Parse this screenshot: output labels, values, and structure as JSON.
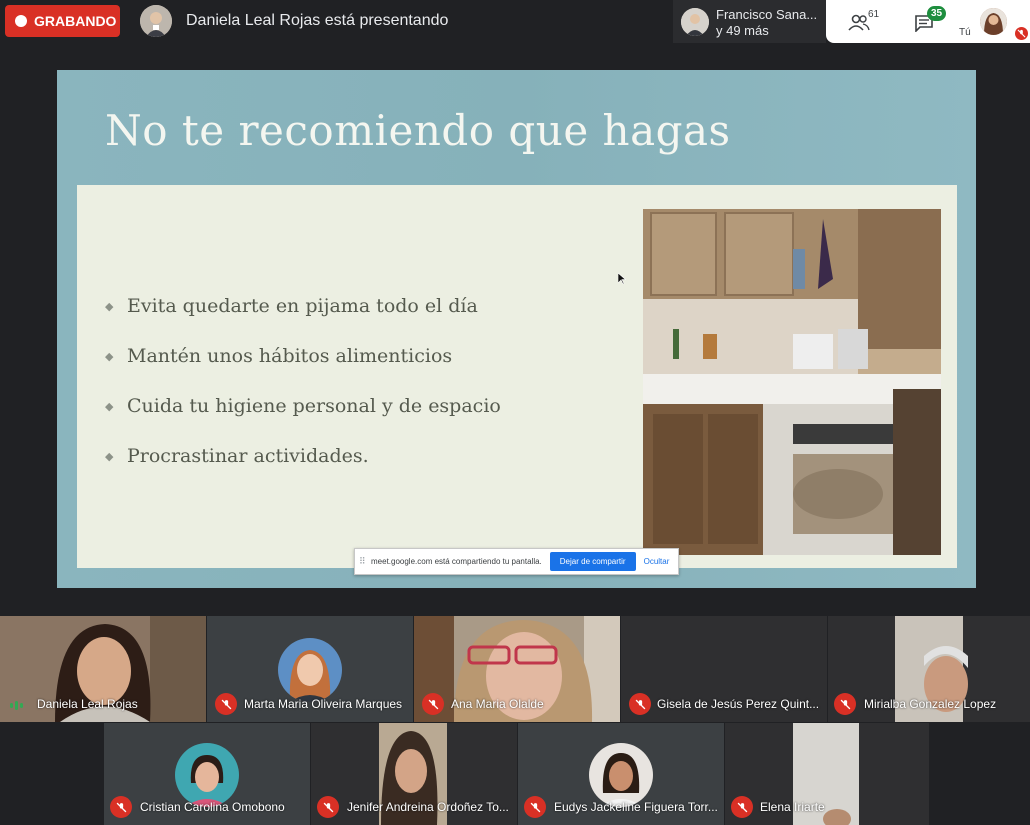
{
  "topbar": {
    "recording_label": "GRABANDO",
    "presenter_text": "Daniela Leal Rojas está presentando",
    "others_line1": "Francisco Sana...",
    "others_line2": "y 49 más",
    "people_count": "61",
    "chat_count": "35",
    "self_label": "Tú"
  },
  "slide": {
    "title": "No te recomiendo que hagas",
    "bullet_mark": "◆",
    "bullets": [
      "Evita quedarte en pijama todo el día",
      "Mantén unos hábitos alimenticios",
      "Cuida tu higiene personal y de espacio",
      "Procrastinar actividades."
    ]
  },
  "share_bar": {
    "handle": "⠿",
    "text": "meet.google.com está compartiendo tu pantalla.",
    "stop_label": "Dejar de compartir",
    "hide_label": "Ocultar"
  },
  "participants": [
    {
      "name": "Daniela Leal Rojas"
    },
    {
      "name": "Marta Maria Oliveira Marques"
    },
    {
      "name": "Ana Maria Olalde"
    },
    {
      "name": "Gisela de Jesús Perez Quint..."
    },
    {
      "name": "Mirialba Gonzalez Lopez"
    },
    {
      "name": "Cristian Carolina Omobono"
    },
    {
      "name": "Jenifer Andreina Ordoñez To..."
    },
    {
      "name": "Eudys Jackeline Figuera Torr..."
    },
    {
      "name": "Elena Iriarte"
    }
  ],
  "colors": {
    "record_red": "#d93025",
    "meet_dark": "#202124",
    "chat_badge_green": "#1e8e3e",
    "share_blue": "#1a73e8"
  }
}
